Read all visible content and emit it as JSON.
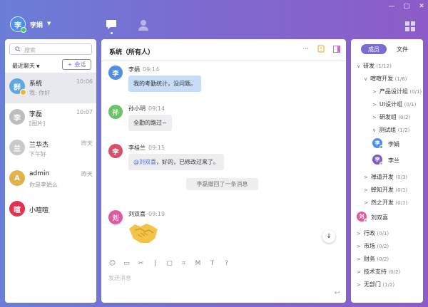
{
  "me": {
    "avatar": "李",
    "name": "李娟"
  },
  "window": {
    "minimize": "—",
    "maximize": "□",
    "close": "✕"
  },
  "left": {
    "search_placeholder": "搜索",
    "recent_label": "最近聊天",
    "new_chat_label": "会话",
    "conversations": [
      {
        "avatar": "群",
        "name": "系统",
        "preview": "我: 你好",
        "time": "10:06",
        "color": "#5fa7df"
      },
      {
        "avatar": "李",
        "name": "李磊",
        "preview": "[图片]",
        "time": "10:07",
        "color": "#bdbdbd"
      },
      {
        "avatar": "兰",
        "name": "兰华杰",
        "preview": "下午好",
        "time": "昨天",
        "color": "#c9c9c9"
      },
      {
        "avatar": "A",
        "name": "admin",
        "preview": "你是李娟么",
        "time": "昨天",
        "color": "#e2b24a"
      },
      {
        "avatar": "暄",
        "name": "小喧喧",
        "preview": "",
        "time": "",
        "color": "#e2324e"
      }
    ]
  },
  "chat": {
    "title": "系统（所有人）",
    "more": "···",
    "messages": [
      {
        "avatar": "李",
        "name": "李娟",
        "time": "09:14",
        "text": "我的考勤统计，没问题。",
        "color": "#4f8ee6"
      },
      {
        "avatar": "孙",
        "name": "孙小明",
        "time": "09:14",
        "text": "全勤的路过~",
        "color": "#6cc26c"
      },
      {
        "avatar": "李",
        "name": "李桂兰",
        "time": "09:15",
        "mention": "@刘双喜",
        "text": "，好的，已修改过来了。",
        "color": "#d8506b"
      },
      {
        "avatar": "刘",
        "name": "刘双喜",
        "time": "09:19",
        "color": "#e05a9c"
      }
    ],
    "recall_notice": "李磊撤回了一条消息",
    "input_placeholder": "发送消息"
  },
  "right": {
    "tabs": [
      "成员",
      "文件"
    ],
    "tree": [
      {
        "label": "研发",
        "count": "(1/12)"
      },
      {
        "label": "喧喧开发",
        "count": "(1/6)"
      },
      {
        "label": "产品设计组",
        "count": "(0/1)"
      },
      {
        "label": "UI设计组",
        "count": "(0/1)"
      },
      {
        "label": "研发组",
        "count": "(0/2)"
      },
      {
        "label": "测试组",
        "count": "(1/2)"
      },
      {
        "label": "李娟",
        "count": ""
      },
      {
        "label": "李兰",
        "count": ""
      },
      {
        "label": "禅道开发",
        "count": "(0/3)"
      },
      {
        "label": "蝉知开发",
        "count": "(0/1)"
      },
      {
        "label": "然之开发",
        "count": "(0/1)"
      },
      {
        "label": "刘双喜",
        "count": ""
      },
      {
        "label": "行政",
        "count": "(0/1)"
      },
      {
        "label": "市场",
        "count": "(0/2)"
      },
      {
        "label": "财务",
        "count": "(0/2)"
      },
      {
        "label": "技术支持",
        "count": "(0/2)"
      },
      {
        "label": "无部门",
        "count": "(1/2)"
      }
    ],
    "avatars": {
      "lijuan": "李",
      "lilan": "李",
      "liushuangxi": "刘"
    }
  }
}
